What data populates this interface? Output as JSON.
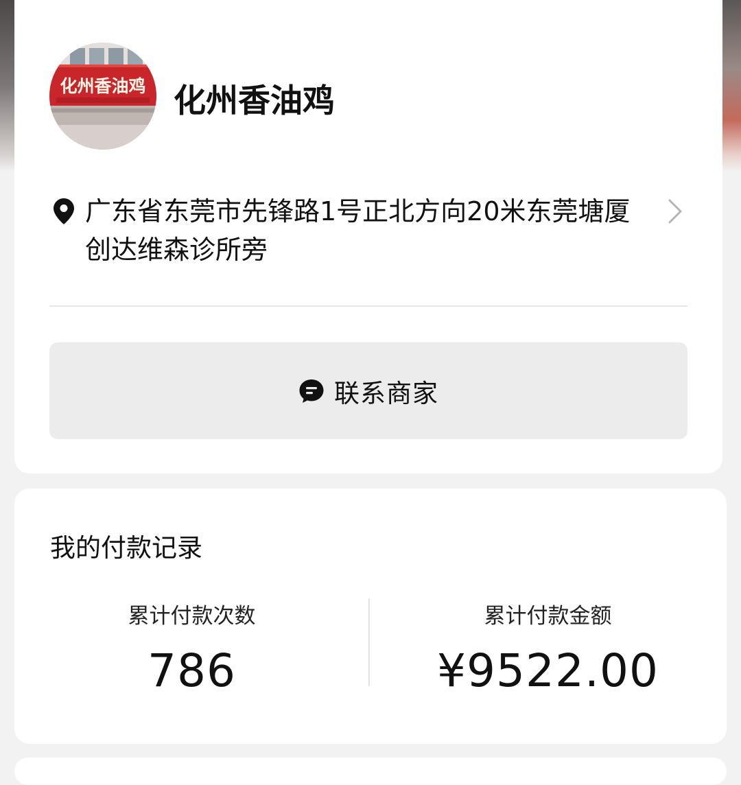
{
  "merchant": {
    "avatar_icon": "storefront-photo",
    "avatar_sign_text": "化州香油鸡",
    "name": "化州香油鸡",
    "address": "广东省东莞市先锋路1号正北方向20米东莞塘厦创达维森诊所旁",
    "address_icon": "location-pin-icon",
    "address_chevron_icon": "chevron-right-icon"
  },
  "contact": {
    "icon": "chat-bubble-icon",
    "label": "联系商家"
  },
  "payment_record": {
    "title": "我的付款记录",
    "count_label": "累计付款次数",
    "count_value": "786",
    "amount_label": "累计付款金额",
    "amount_value": "¥9522.00"
  },
  "colors": {
    "card_bg": "#ffffff",
    "page_bg": "#f2f2f2",
    "button_bg": "#ececec",
    "text_primary": "#111111",
    "sign_red": "#c8262a"
  }
}
